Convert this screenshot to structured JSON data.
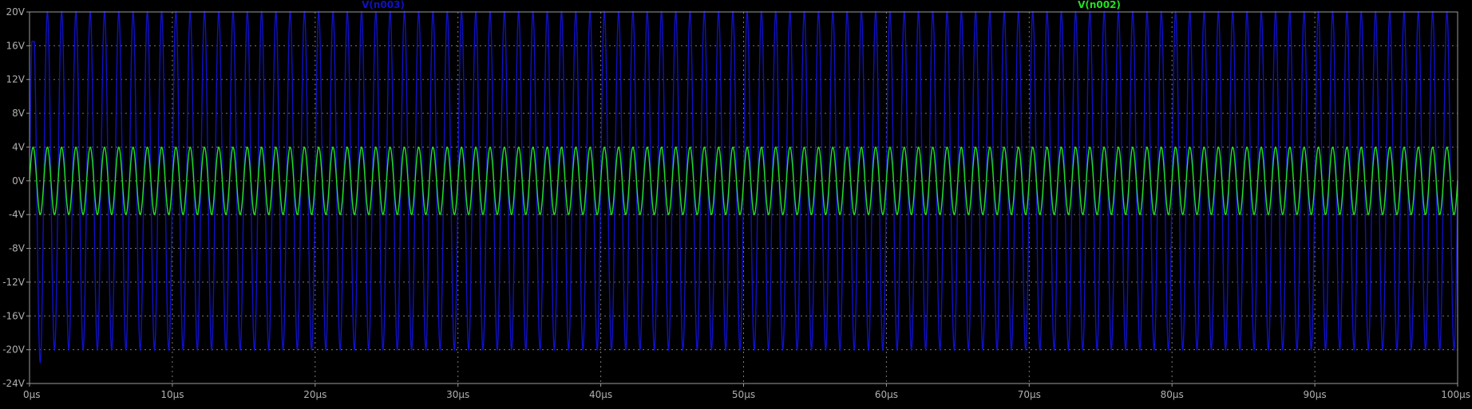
{
  "chart_data": {
    "type": "line",
    "title": "",
    "xlabel": "",
    "ylabel": "",
    "xlim": [
      0,
      100
    ],
    "ylim": [
      -24,
      20
    ],
    "x_ticks": [
      0,
      10,
      20,
      30,
      40,
      50,
      60,
      70,
      80,
      90,
      100
    ],
    "x_tick_labels": [
      "0µs",
      "10µs",
      "20µs",
      "30µs",
      "40µs",
      "50µs",
      "60µs",
      "70µs",
      "80µs",
      "90µs",
      "100µs"
    ],
    "y_ticks": [
      20,
      16,
      12,
      8,
      4,
      0,
      -4,
      -8,
      -12,
      -16,
      -20,
      -24
    ],
    "y_tick_labels": [
      "20V",
      "16V",
      "12V",
      "8V",
      "4V",
      "0V",
      "-4V",
      "-8V",
      "-12V",
      "-16V",
      "-20V",
      "-24V"
    ],
    "grid": true,
    "series": [
      {
        "name": "V(n003)",
        "color": "#1010c8",
        "waveform": "sine",
        "frequency_mhz": 1.0,
        "amplitude_v": 20,
        "offset_v": 0,
        "startup_min_v": -21.5,
        "startup_max_v": 16.5
      },
      {
        "name": "V(n002)",
        "color": "#22e022",
        "waveform": "sine",
        "frequency_mhz": 1.0,
        "amplitude_v": 4,
        "offset_v": 0
      }
    ]
  },
  "colors": {
    "background": "#000000",
    "axis": "#9a9a9a",
    "grid": "#7a7a7a",
    "tick_text": "#b0b0b0"
  }
}
